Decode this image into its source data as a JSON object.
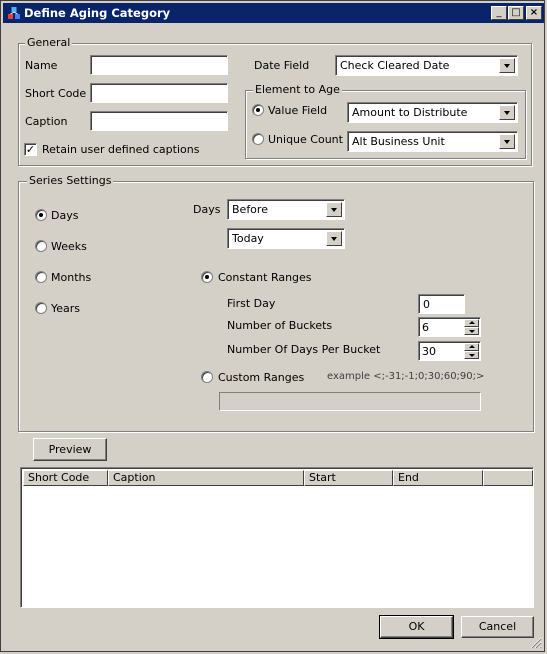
{
  "window": {
    "title": "Define Aging Category",
    "controls": {
      "minimize": "_",
      "maximize": "□",
      "close": "×"
    }
  },
  "general": {
    "legend": "General",
    "name_label": "Name",
    "name_value": "",
    "short_code_label": "Short Code",
    "short_code_value": "",
    "caption_label": "Caption",
    "caption_value": "",
    "retain_label": "Retain user defined captions",
    "retain_checked": true,
    "date_field_label": "Date Field",
    "date_field_value": "Check Cleared Date",
    "element_to_age": {
      "legend": "Element to Age",
      "value_field_label": "Value Field",
      "value_field_value": "Amount to Distribute",
      "unique_count_label": "Unique Count",
      "unique_count_value": "Alt Business Unit",
      "selected": "value_field"
    }
  },
  "series": {
    "legend": "Series Settings",
    "periods": [
      "Days",
      "Weeks",
      "Months",
      "Years"
    ],
    "selected_period": "Days",
    "days_label": "Days",
    "relation_value": "Before",
    "anchor_value": "Today",
    "constant_ranges_label": "Constant Ranges",
    "first_day_label": "First Day",
    "first_day_value": "0",
    "buckets_label": "Number of Buckets",
    "buckets_value": "6",
    "days_per_bucket_label": "Number Of Days Per Bucket",
    "days_per_bucket_value": "30",
    "custom_ranges_label": "Custom Ranges",
    "custom_ranges_example": "example <;-31;-1;0;30;60;90;>",
    "custom_ranges_value": ""
  },
  "preview": {
    "button_label": "Preview",
    "columns": [
      "Short Code",
      "Caption",
      "Start",
      "End"
    ],
    "rows": []
  },
  "footer": {
    "ok_label": "OK",
    "cancel_label": "Cancel"
  }
}
